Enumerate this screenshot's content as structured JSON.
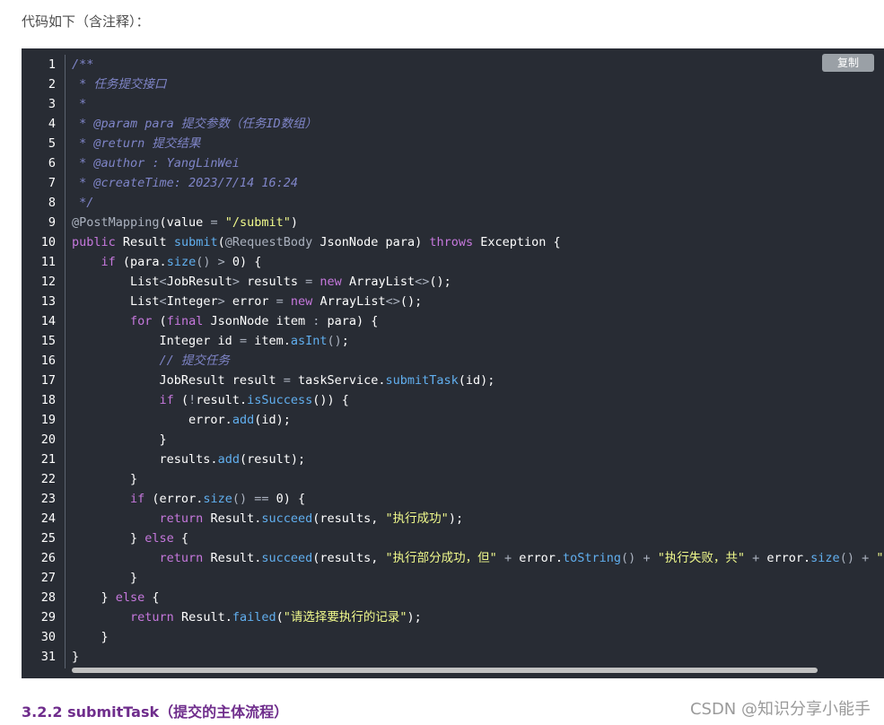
{
  "intro_text": "代码如下（含注释）：",
  "copy_label": "复制",
  "heading": "3.2.2 submitTask（提交的主体流程）",
  "watermark": "CSDN @知识分享小能手",
  "code_lines": [
    {
      "n": "1",
      "t": [
        [
          "c",
          "/**"
        ]
      ]
    },
    {
      "n": "2",
      "t": [
        [
          "c",
          " * 任务提交接口"
        ]
      ]
    },
    {
      "n": "3",
      "t": [
        [
          "c",
          " *"
        ]
      ]
    },
    {
      "n": "4",
      "t": [
        [
          "c",
          " * @param para 提交参数（任务ID数组）"
        ]
      ]
    },
    {
      "n": "5",
      "t": [
        [
          "c",
          " * @return 提交结果"
        ]
      ]
    },
    {
      "n": "6",
      "t": [
        [
          "c",
          " * @author : YangLinWei"
        ]
      ]
    },
    {
      "n": "7",
      "t": [
        [
          "c",
          " * @createTime: 2023/7/14 16:24"
        ]
      ]
    },
    {
      "n": "8",
      "t": [
        [
          "c",
          " */"
        ]
      ]
    },
    {
      "n": "9",
      "t": [
        [
          "a",
          "@PostMapping"
        ],
        [
          "",
          "(value "
        ],
        [
          "o",
          "="
        ],
        [
          "",
          " "
        ],
        [
          "s",
          "\"/submit\""
        ],
        [
          "",
          ")"
        ]
      ]
    },
    {
      "n": "10",
      "t": [
        [
          "k",
          "public"
        ],
        [
          "",
          " Result "
        ],
        [
          "f",
          "submit"
        ],
        [
          "",
          "("
        ],
        [
          "a",
          "@RequestBody"
        ],
        [
          "",
          " JsonNode para) "
        ],
        [
          "k",
          "throws"
        ],
        [
          "",
          " Exception {"
        ]
      ]
    },
    {
      "n": "11",
      "t": [
        [
          "",
          "    "
        ],
        [
          "k",
          "if"
        ],
        [
          "",
          " (para."
        ],
        [
          "f",
          "size"
        ],
        [
          "o",
          "()"
        ],
        [
          "",
          " "
        ],
        [
          "o",
          ">"
        ],
        [
          "",
          " 0) {"
        ]
      ]
    },
    {
      "n": "12",
      "t": [
        [
          "",
          "        List"
        ],
        [
          "o",
          "<"
        ],
        [
          "",
          "JobResult"
        ],
        [
          "o",
          ">"
        ],
        [
          "",
          " results "
        ],
        [
          "o",
          "="
        ],
        [
          "",
          " "
        ],
        [
          "k",
          "new"
        ],
        [
          "",
          " ArrayList"
        ],
        [
          "o",
          "<>"
        ],
        [
          "",
          "();"
        ]
      ]
    },
    {
      "n": "13",
      "t": [
        [
          "",
          "        List"
        ],
        [
          "o",
          "<"
        ],
        [
          "",
          "Integer"
        ],
        [
          "o",
          ">"
        ],
        [
          "",
          " error "
        ],
        [
          "o",
          "="
        ],
        [
          "",
          " "
        ],
        [
          "k",
          "new"
        ],
        [
          "",
          " ArrayList"
        ],
        [
          "o",
          "<>"
        ],
        [
          "",
          "();"
        ]
      ]
    },
    {
      "n": "14",
      "t": [
        [
          "",
          "        "
        ],
        [
          "k",
          "for"
        ],
        [
          "",
          " ("
        ],
        [
          "k",
          "final"
        ],
        [
          "",
          " JsonNode item "
        ],
        [
          "o",
          ":"
        ],
        [
          "",
          " para) {"
        ]
      ]
    },
    {
      "n": "15",
      "t": [
        [
          "",
          "            Integer id "
        ],
        [
          "o",
          "="
        ],
        [
          "",
          " item."
        ],
        [
          "f",
          "asInt"
        ],
        [
          "o",
          "()"
        ],
        [
          "",
          ";"
        ]
      ]
    },
    {
      "n": "16",
      "t": [
        [
          "",
          "            "
        ],
        [
          "c",
          "// 提交任务"
        ]
      ]
    },
    {
      "n": "17",
      "t": [
        [
          "",
          "            JobResult result "
        ],
        [
          "o",
          "="
        ],
        [
          "",
          " taskService."
        ],
        [
          "f",
          "submitTask"
        ],
        [
          "",
          "(id);"
        ]
      ]
    },
    {
      "n": "18",
      "t": [
        [
          "",
          "            "
        ],
        [
          "k",
          "if"
        ],
        [
          "",
          " ("
        ],
        [
          "o",
          "!"
        ],
        [
          "",
          "result."
        ],
        [
          "f",
          "isSuccess"
        ],
        [
          "",
          "()) {"
        ]
      ]
    },
    {
      "n": "19",
      "t": [
        [
          "",
          "                error."
        ],
        [
          "f",
          "add"
        ],
        [
          "",
          "(id);"
        ]
      ]
    },
    {
      "n": "20",
      "t": [
        [
          "",
          "            }"
        ]
      ]
    },
    {
      "n": "21",
      "t": [
        [
          "",
          "            results."
        ],
        [
          "f",
          "add"
        ],
        [
          "",
          "(result);"
        ]
      ]
    },
    {
      "n": "22",
      "t": [
        [
          "",
          "        }"
        ]
      ]
    },
    {
      "n": "23",
      "t": [
        [
          "",
          "        "
        ],
        [
          "k",
          "if"
        ],
        [
          "",
          " (error."
        ],
        [
          "f",
          "size"
        ],
        [
          "o",
          "()"
        ],
        [
          "",
          " "
        ],
        [
          "o",
          "=="
        ],
        [
          "",
          " 0) {"
        ]
      ]
    },
    {
      "n": "24",
      "t": [
        [
          "",
          "            "
        ],
        [
          "k",
          "return"
        ],
        [
          "",
          " Result."
        ],
        [
          "f",
          "succeed"
        ],
        [
          "",
          "(results, "
        ],
        [
          "s",
          "\"执行成功\""
        ],
        [
          "",
          ");"
        ]
      ]
    },
    {
      "n": "25",
      "t": [
        [
          "",
          "        } "
        ],
        [
          "k",
          "else"
        ],
        [
          "",
          " {"
        ]
      ]
    },
    {
      "n": "26",
      "t": [
        [
          "",
          "            "
        ],
        [
          "k",
          "return"
        ],
        [
          "",
          " Result."
        ],
        [
          "f",
          "succeed"
        ],
        [
          "",
          "(results, "
        ],
        [
          "s",
          "\"执行部分成功，但\""
        ],
        [
          "",
          " "
        ],
        [
          "o",
          "+"
        ],
        [
          "",
          " error."
        ],
        [
          "f",
          "toString"
        ],
        [
          "o",
          "()"
        ],
        [
          "",
          " "
        ],
        [
          "o",
          "+"
        ],
        [
          "",
          " "
        ],
        [
          "s",
          "\"执行失败，共\""
        ],
        [
          "",
          " "
        ],
        [
          "o",
          "+"
        ],
        [
          "",
          " error."
        ],
        [
          "f",
          "size"
        ],
        [
          "o",
          "()"
        ],
        [
          "",
          " "
        ],
        [
          "o",
          "+"
        ],
        [
          "",
          " "
        ],
        [
          "s",
          "\"次失"
        ]
      ]
    },
    {
      "n": "27",
      "t": [
        [
          "",
          "        }"
        ]
      ]
    },
    {
      "n": "28",
      "t": [
        [
          "",
          "    } "
        ],
        [
          "k",
          "else"
        ],
        [
          "",
          " {"
        ]
      ]
    },
    {
      "n": "29",
      "t": [
        [
          "",
          "        "
        ],
        [
          "k",
          "return"
        ],
        [
          "",
          " Result."
        ],
        [
          "f",
          "failed"
        ],
        [
          "",
          "("
        ],
        [
          "s",
          "\"请选择要执行的记录\""
        ],
        [
          "",
          ");"
        ]
      ]
    },
    {
      "n": "30",
      "t": [
        [
          "",
          "    }"
        ]
      ]
    },
    {
      "n": "31",
      "t": [
        [
          "",
          "}"
        ]
      ]
    }
  ]
}
